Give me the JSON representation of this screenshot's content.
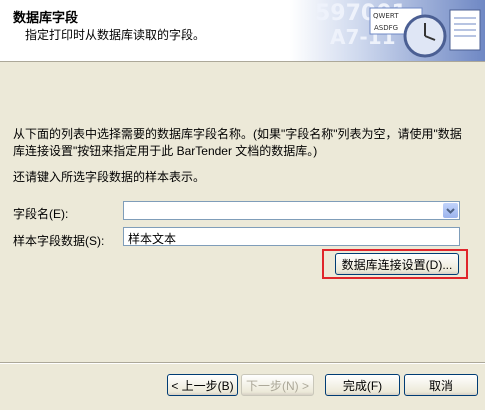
{
  "header": {
    "title": "数据库字段",
    "subtitle": "指定打印时从数据库读取的字段。",
    "graphic_text": [
      "597001",
      "A7-11",
      "QWERT",
      "ASDFG"
    ]
  },
  "content": {
    "description": "从下面的列表中选择需要的数据库字段名称。(如果\"字段名称\"列表为空，请使用\"数据库连接设置\"按钮来指定用于此 BarTender 文档的数据库。)",
    "sample_prompt": "还请键入所选字段数据的样本表示。"
  },
  "fields": {
    "field_name_label": "字段名(E):",
    "field_name_value": "",
    "sample_label": "样本字段数据(S):",
    "sample_value": "样本文本"
  },
  "buttons": {
    "db_settings": "数据库连接设置(D)...",
    "back": "< 上一步(B)",
    "next": "下一步(N) >",
    "finish": "完成(F)",
    "cancel": "取消"
  },
  "colors": {
    "highlight": "#e0262b"
  }
}
